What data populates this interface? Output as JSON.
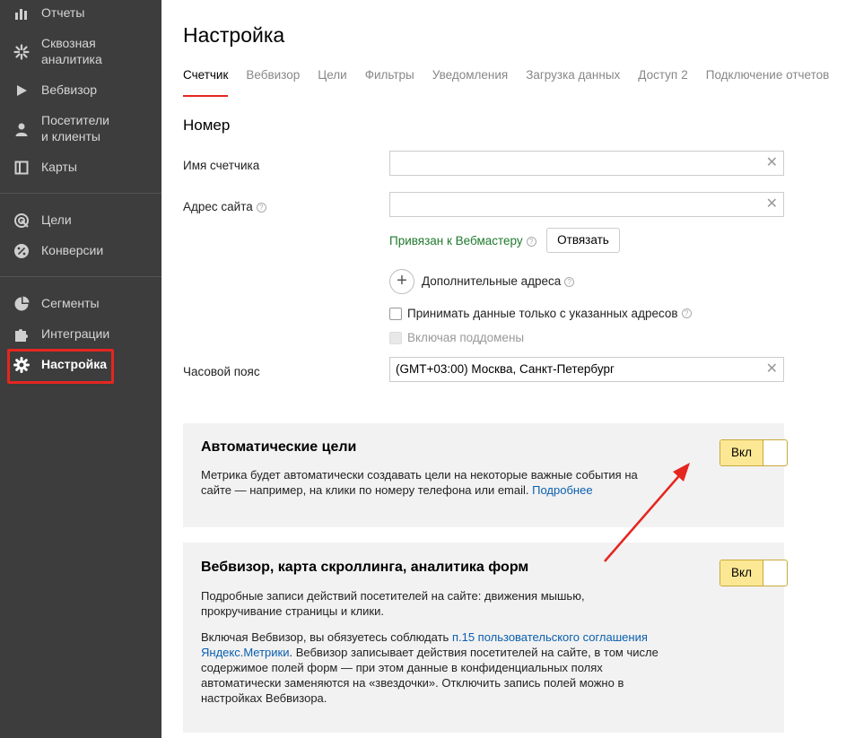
{
  "sidebar": {
    "items": [
      {
        "label": "Отчеты",
        "icon": "bar-chart-icon"
      },
      {
        "label": "Сквозная\nаналитика",
        "line1": "Сквозная",
        "line2": "аналитика",
        "icon": "sparkle-icon"
      },
      {
        "label": "Вебвизор",
        "icon": "play-icon"
      },
      {
        "label": "Посетители",
        "line1": "Посетители",
        "line2": "и клиенты",
        "icon": "person-icon"
      },
      {
        "label": "Карты",
        "icon": "map-icon"
      },
      {
        "label": "Цели",
        "icon": "target-icon"
      },
      {
        "label": "Конверсии",
        "icon": "percent-icon"
      },
      {
        "label": "Сегменты",
        "icon": "pie-icon"
      },
      {
        "label": "Интеграции",
        "icon": "puzzle-icon"
      },
      {
        "label": "Настройка",
        "icon": "gear-icon"
      }
    ]
  },
  "page": {
    "title": "Настройка"
  },
  "tabs": [
    {
      "label": "Счетчик",
      "active": true
    },
    {
      "label": "Вебвизор"
    },
    {
      "label": "Цели"
    },
    {
      "label": "Фильтры"
    },
    {
      "label": "Уведомления"
    },
    {
      "label": "Загрузка данных"
    },
    {
      "label": "Доступ",
      "count": "2"
    },
    {
      "label": "Подключение отчетов"
    }
  ],
  "counter": {
    "section_title": "Номер",
    "name_label": "Имя счетчика",
    "name_value": "",
    "site_label": "Адрес сайта",
    "site_value": "",
    "webmaster_link": "Привязан к Вебмастеру",
    "unlink_button": "Отвязать",
    "extra_addresses": "Дополнительные адреса",
    "only_specified": "Принимать данные только с указанных адресов",
    "include_subdomains": "Включая поддомены",
    "timezone_label": "Часовой пояс",
    "timezone_value": "(GMT+03:00) Москва, Санкт-Петербург"
  },
  "auto_goals": {
    "title": "Автоматические цели",
    "text": "Метрика будет автоматически создавать цели на некоторые важные события на сайте — например, на клики по номеру телефона или email.",
    "link": "Подробнее",
    "toggle_label": "Вкл"
  },
  "webvisor": {
    "title": "Вебвизор, карта скроллинга, аналитика форм",
    "text1": "Подробные записи действий посетителей на сайте: движения мышью, прокручивание страницы и клики.",
    "text2_before": "Включая Вебвизор, вы обязуетесь соблюдать",
    "text2_link": "п.15 пользовательского соглашения Яндекс.Метрики",
    "text2_after": ". Вебвизор записывает действия посетителей на сайте, в том числе содержимое полей форм — при этом данные в конфиденциальных полях автоматически заменяются на «звездочки». Отключить запись полей можно в настройках Вебвизора.",
    "toggle_label": "Вкл"
  },
  "colors": {
    "sidebar_bg": "#3d3d3d",
    "accent_red": "#e52620",
    "toggle_yellow": "#fce894",
    "link_blue": "#0b5fae",
    "link_green": "#1e7a2c",
    "panel_bg": "#f2f2f2"
  }
}
